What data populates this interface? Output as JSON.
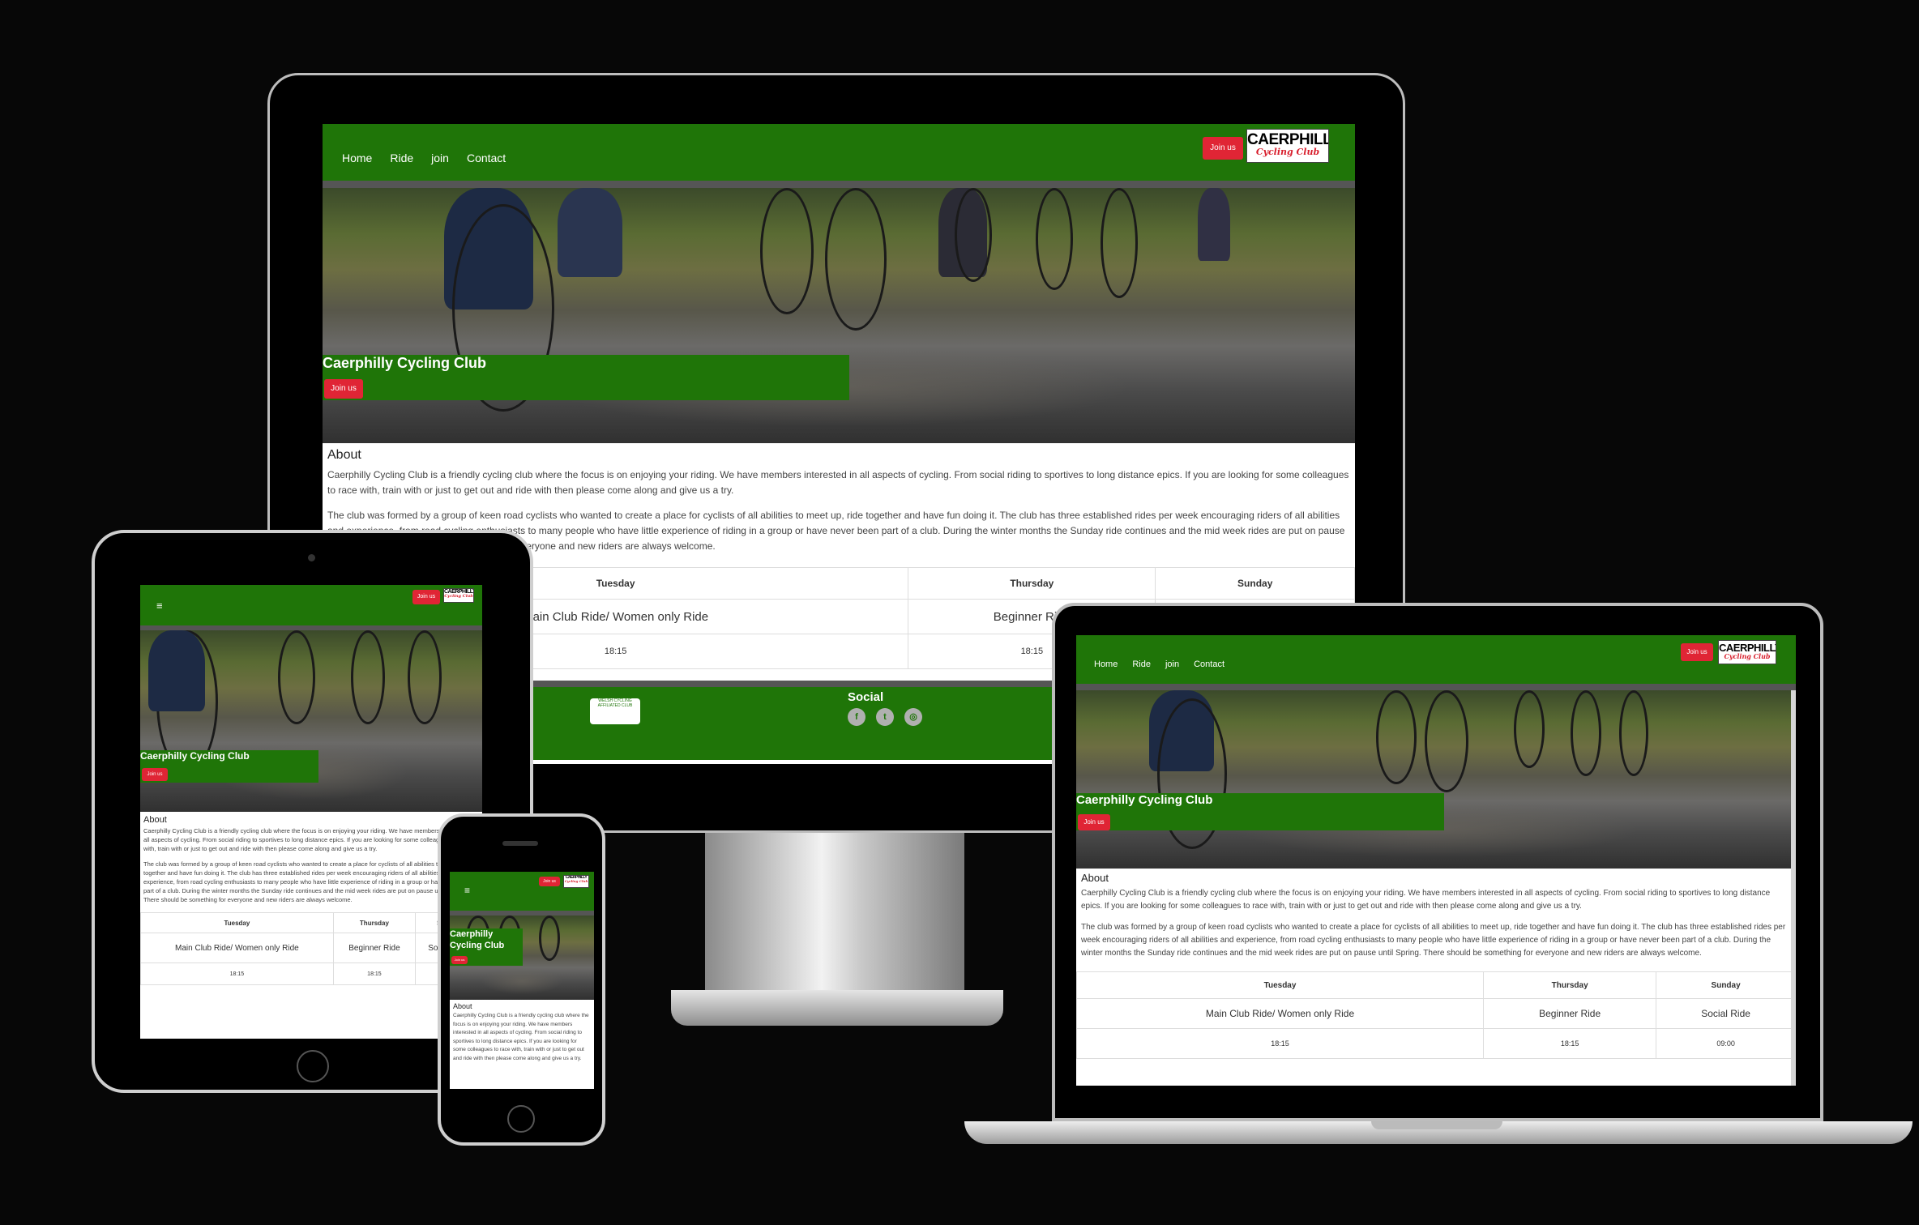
{
  "site": {
    "nav": {
      "home": "Home",
      "ride": "Ride",
      "join": "join",
      "contact": "Contact",
      "menu_icon": "≡"
    },
    "join_button": "Join us",
    "logo": {
      "line1": "CAERPHILLY",
      "line2": "Cycling Club"
    },
    "hero": {
      "title": "Caerphilly Cycling Club",
      "cta": "Join us"
    },
    "about": {
      "heading": "About",
      "p1": "Caerphilly Cycling Club is a friendly cycling club where the focus is on enjoying your riding. We have members interested in all aspects of cycling. From social riding to sportives to long distance epics. If you are looking for some colleagues to race with, train with or just to get out and ride with then please come along and give us a try.",
      "p2": "The club was formed by a group of keen road cyclists who wanted to create a place for cyclists of all abilities to meet up, ride together and have fun doing it. The club has three established rides per week encouraging riders of all abilities and experience, from road cycling enthusiasts to many people who have little experience of riding in a group or have never been part of a club. During the winter months the Sunday ride continues and the mid week rides are put on pause until Spring. There should be something for everyone and new riders are always welcome."
    },
    "rides": {
      "headers": [
        "Tuesday",
        "Thursday",
        "Sunday"
      ],
      "names": [
        "Main Club Ride/ Women only Ride",
        "Beginner Ride",
        "Social Ride"
      ],
      "times": [
        "18:15",
        "18:15",
        "09:00"
      ]
    },
    "footer": {
      "social_heading": "Social",
      "badge_text": "WELSH CYCLING AFFILIATED CLUB",
      "social_icons": [
        "f",
        "t",
        "◎"
      ]
    }
  },
  "colors": {
    "brand_green": "#1f7508",
    "join_red": "#e02535",
    "background": "#070707"
  }
}
